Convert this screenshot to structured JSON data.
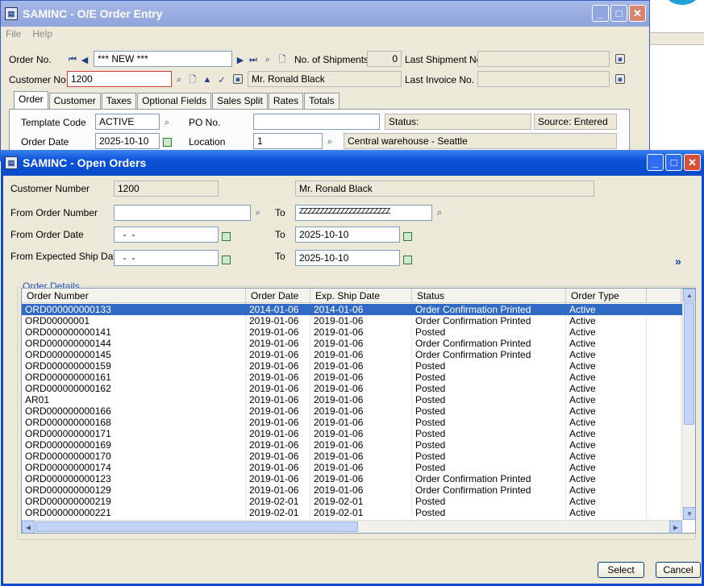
{
  "bg_window": {
    "title": "SAMINC - O/E Order Entry",
    "menu": [
      "File",
      "Help"
    ],
    "order_no_label": "Order No.",
    "order_no_value": "*** NEW ***",
    "shipments_label": "No. of Shipments",
    "shipments_value": "0",
    "last_shipment_label": "Last Shipment No.",
    "customer_no_label": "Customer No.",
    "customer_no_value": "1200",
    "customer_name": "Mr. Ronald Black",
    "last_invoice_label": "Last Invoice No.",
    "tabs": [
      "Order",
      "Customer",
      "Taxes",
      "Optional Fields",
      "Sales Split",
      "Rates",
      "Totals"
    ],
    "template_code_label": "Template Code",
    "template_code_value": "ACTIVE",
    "po_no_label": "PO No.",
    "status_label": "Status:",
    "source_label": "Source: Entered",
    "order_date_label": "Order Date",
    "order_date_value": "2025-10-10",
    "location_label": "Location",
    "location_value": "1",
    "location_desc": "Central warehouse - Seattle"
  },
  "dialog": {
    "title": "SAMINC - Open Orders",
    "customer_number_label": "Customer Number",
    "customer_number_value": "1200",
    "customer_name": "Mr. Ronald Black",
    "from_order_number_label": "From Order Number",
    "from_order_number_value": "",
    "to_label": "To",
    "to_order_number_value": "ZZZZZZZZZZZZZZZZZZZZZZ",
    "from_order_date_label": "From Order Date",
    "from_order_date_value": "  -  -",
    "to_order_date_value": "2025-10-10",
    "from_ship_date_label": "From Expected Ship Date",
    "from_ship_date_value": "  -  -",
    "to_ship_date_value": "2025-10-10",
    "group_label": "Order Details",
    "columns": [
      "Order Number",
      "Order Date",
      "Exp. Ship Date",
      "Status",
      "Order Type",
      ""
    ],
    "rows": [
      [
        "ORD000000000133",
        "2014-01-06",
        "2014-01-06",
        "Order Confirmation Printed",
        "Active"
      ],
      [
        "ORD00000001",
        "2019-01-06",
        "2019-01-06",
        "Order Confirmation Printed",
        "Active"
      ],
      [
        "ORD000000000141",
        "2019-01-06",
        "2019-01-06",
        "Posted",
        "Active"
      ],
      [
        "ORD000000000144",
        "2019-01-06",
        "2019-01-06",
        "Order Confirmation Printed",
        "Active"
      ],
      [
        "ORD000000000145",
        "2019-01-06",
        "2019-01-06",
        "Order Confirmation Printed",
        "Active"
      ],
      [
        "ORD000000000159",
        "2019-01-06",
        "2019-01-06",
        "Posted",
        "Active"
      ],
      [
        "ORD000000000161",
        "2019-01-06",
        "2019-01-06",
        "Posted",
        "Active"
      ],
      [
        "ORD000000000162",
        "2019-01-06",
        "2019-01-06",
        "Posted",
        "Active"
      ],
      [
        "AR01",
        "2019-01-06",
        "2019-01-06",
        "Posted",
        "Active"
      ],
      [
        "ORD000000000166",
        "2019-01-06",
        "2019-01-06",
        "Posted",
        "Active"
      ],
      [
        "ORD000000000168",
        "2019-01-06",
        "2019-01-06",
        "Posted",
        "Active"
      ],
      [
        "ORD000000000171",
        "2019-01-06",
        "2019-01-06",
        "Posted",
        "Active"
      ],
      [
        "ORD000000000169",
        "2019-01-06",
        "2019-01-06",
        "Posted",
        "Active"
      ],
      [
        "ORD000000000170",
        "2019-01-06",
        "2019-01-06",
        "Posted",
        "Active"
      ],
      [
        "ORD000000000174",
        "2019-01-06",
        "2019-01-06",
        "Posted",
        "Active"
      ],
      [
        "ORD000000000123",
        "2019-01-06",
        "2019-01-06",
        "Order Confirmation Printed",
        "Active"
      ],
      [
        "ORD000000000129",
        "2019-01-06",
        "2019-01-06",
        "Order Confirmation Printed",
        "Active"
      ],
      [
        "ORD000000000219",
        "2019-02-01",
        "2019-02-01",
        "Posted",
        "Active"
      ],
      [
        "ORD000000000221",
        "2019-02-01",
        "2019-02-01",
        "Posted",
        "Active"
      ]
    ],
    "selected_row": 0,
    "select_button": "Select",
    "cancel_button": "Cancel"
  },
  "icons": {
    "search": "magnifier-icon",
    "finder_cal": "calendar-icon"
  },
  "colors": {
    "title_active": "#0b52d9",
    "selection": "#316ac5",
    "window_bg": "#ece9d8"
  }
}
